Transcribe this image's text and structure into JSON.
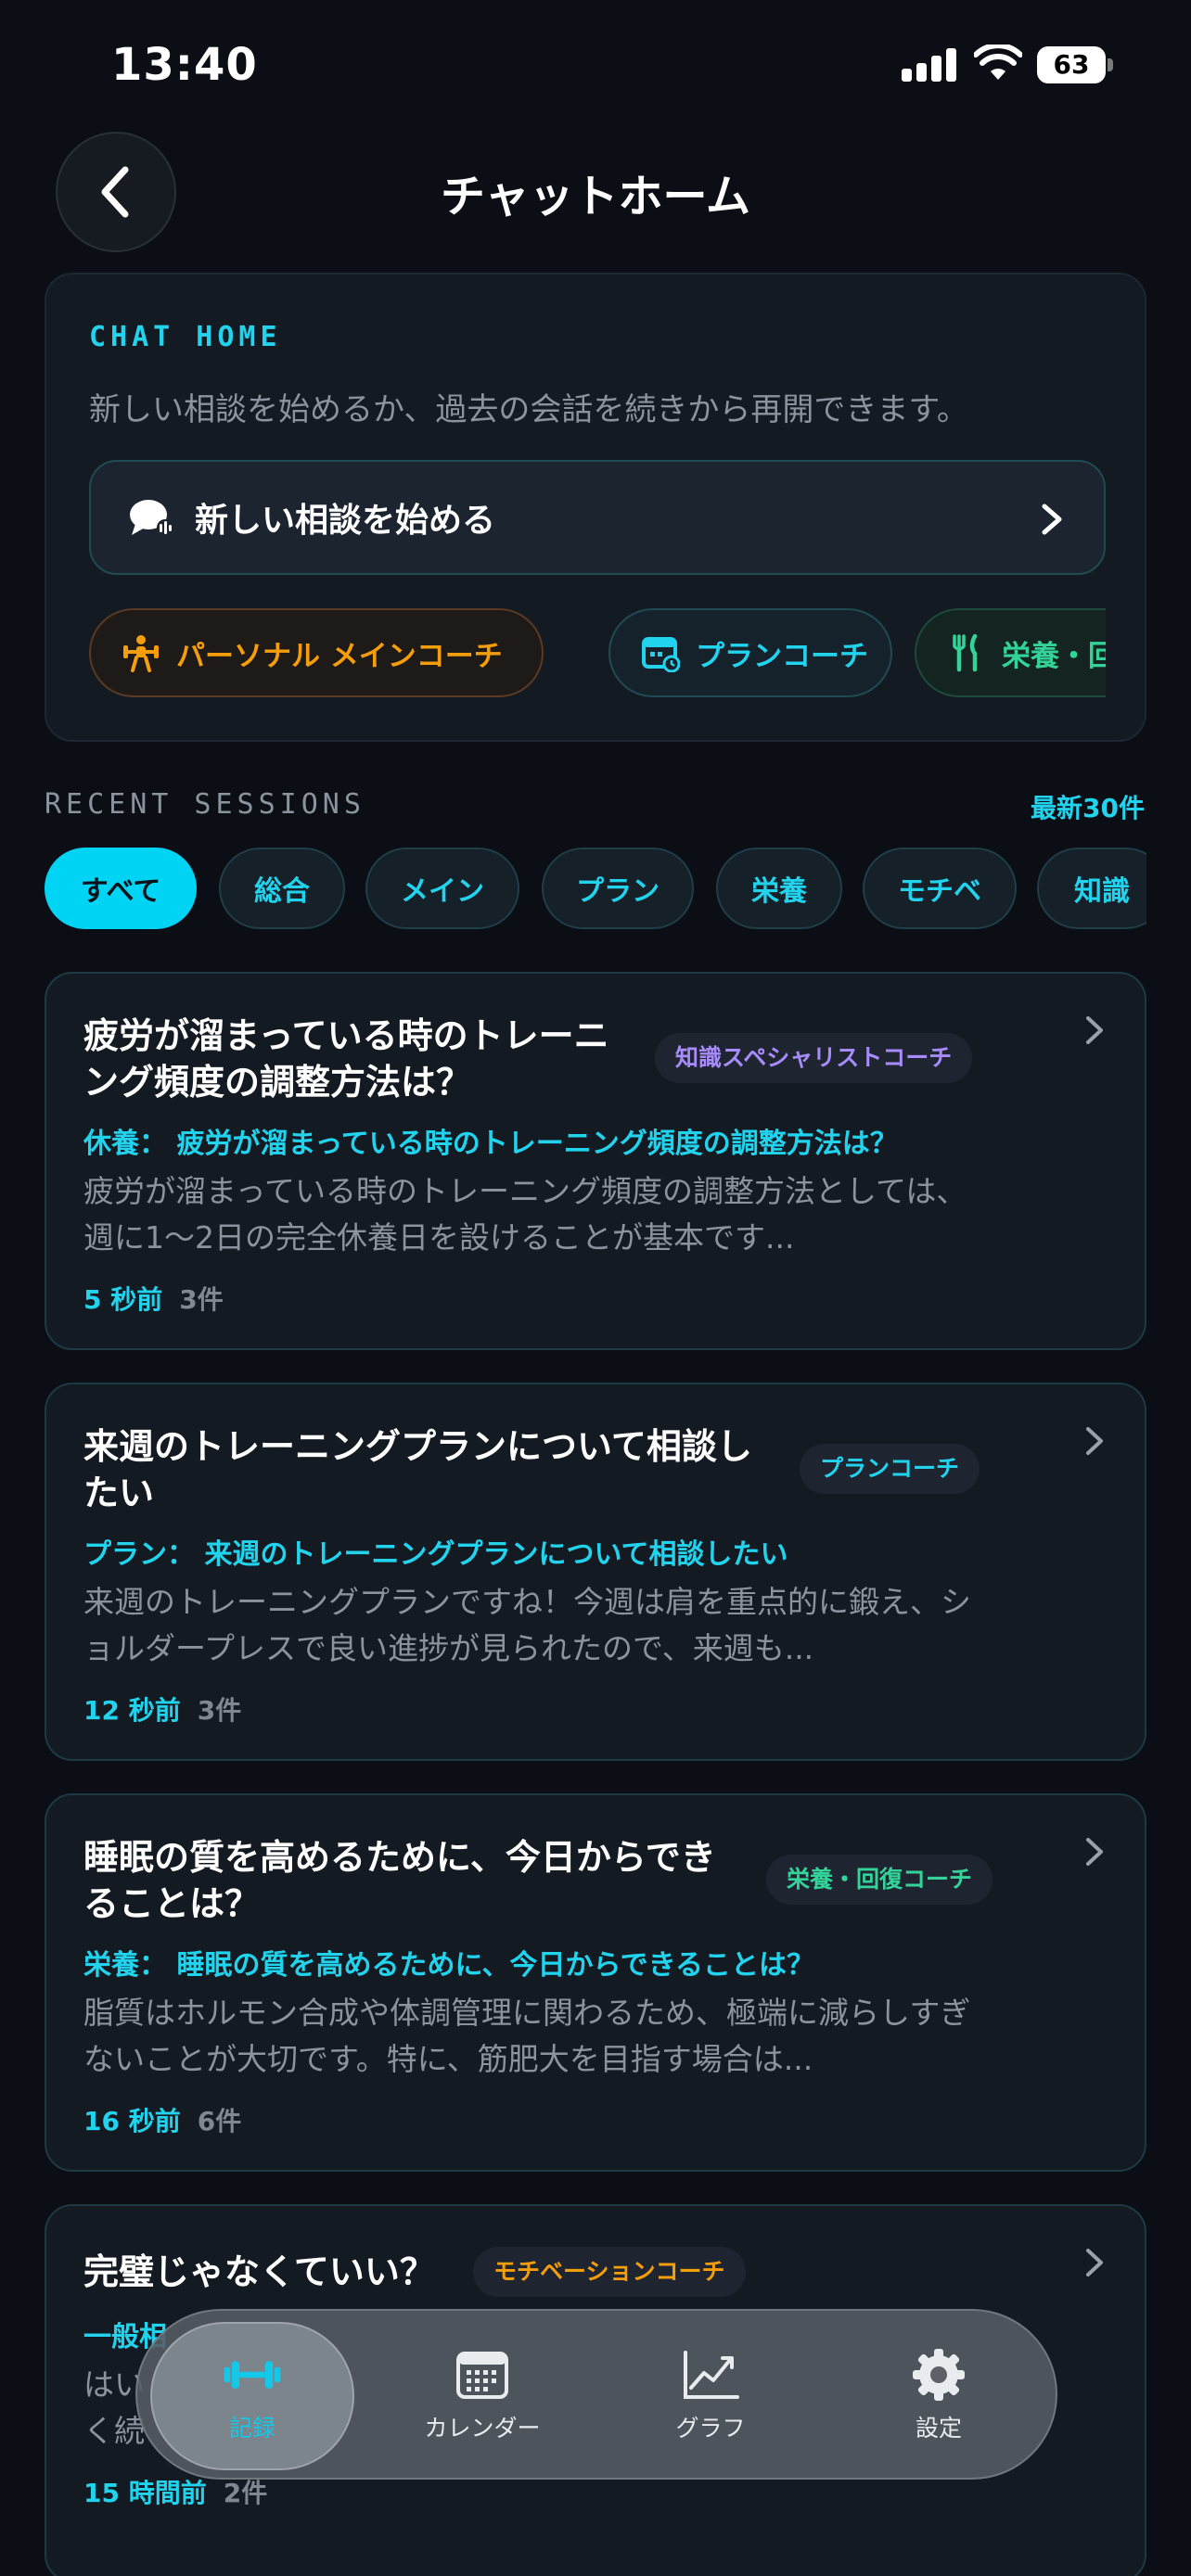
{
  "status_bar": {
    "time": "13:40",
    "battery": "63"
  },
  "header": {
    "title": "チャットホーム"
  },
  "chat_home": {
    "label": "CHAT HOME",
    "description": "新しい相談を始めるか、過去の会話を続きから再開できます。",
    "new_chat_label": "新しい相談を始める",
    "coaches": [
      {
        "label": "パーソナル メインコーチ",
        "color": "#f59e0b",
        "icon": "trainer-icon"
      },
      {
        "label": "プランコーチ",
        "color": "#22d3ee",
        "icon": "calendar-plan-icon"
      },
      {
        "label": "栄養・回復コーチ",
        "color": "#34d399",
        "icon": "utensils-icon"
      }
    ]
  },
  "recent": {
    "label": "RECENT SESSIONS",
    "count": "最新30件",
    "filters": [
      "すべて",
      "総合",
      "メイン",
      "プラン",
      "栄養",
      "モチベ",
      "知識"
    ],
    "active_filter": "すべて"
  },
  "sessions": [
    {
      "title_line1": "疲労が溜まっている時のトレーニ",
      "title_line2": "ング頻度の調整方法は？",
      "badge": "知識スペシャリストコーチ",
      "badge_color": "#a78bfa",
      "subtitle": "休養： 疲労が溜まっている時のトレーニング頻度の調整方法は？",
      "preview_line1": "疲労が溜まっている時のトレーニング頻度の調整方法としては、",
      "preview_line2": "週に1〜2日の完全休養日を設けることが基本です...",
      "time": "5 秒前",
      "count": "3件"
    },
    {
      "title_line1": "来週のトレーニングプランについて相談し",
      "title_line2": "たい",
      "badge": "プランコーチ",
      "badge_color": "#22d3ee",
      "subtitle": "プラン： 来週のトレーニングプランについて相談したい",
      "preview_line1": "来週のトレーニングプランですね！今週は肩を重点的に鍛え、シ",
      "preview_line2": "ョルダープレスで良い進捗が見られたので、来週も...",
      "time": "12 秒前",
      "count": "3件"
    },
    {
      "title_line1": "睡眠の質を高めるために、今日からでき",
      "title_line2": "ることは？",
      "badge": "栄養・回復コーチ",
      "badge_color": "#34d399",
      "subtitle": "栄養： 睡眠の質を高めるために、今日からできることは？",
      "preview_line1": "脂質はホルモン合成や体調管理に関わるため、極端に減らしすぎ",
      "preview_line2": "ないことが大切です。特に、筋肥大を目指す場合は...",
      "time": "16 秒前",
      "count": "6件"
    },
    {
      "title_line1": "完璧じゃなくていい？",
      "title_line2": "",
      "badge": "モチベーションコーチ",
      "badge_color": "#f59e0b",
      "subtitle": "一般相",
      "preview_line1": "はい",
      "preview_line2": "く続",
      "time": "15 時間前",
      "count": "2件"
    }
  ],
  "tab_bar": {
    "tabs": [
      {
        "label": "記録",
        "icon": "dumbbell-icon",
        "active": true
      },
      {
        "label": "カレンダー",
        "icon": "calendar-icon",
        "active": false
      },
      {
        "label": "グラフ",
        "icon": "chart-icon",
        "active": false
      },
      {
        "label": "設定",
        "icon": "gear-icon",
        "active": false
      }
    ]
  }
}
